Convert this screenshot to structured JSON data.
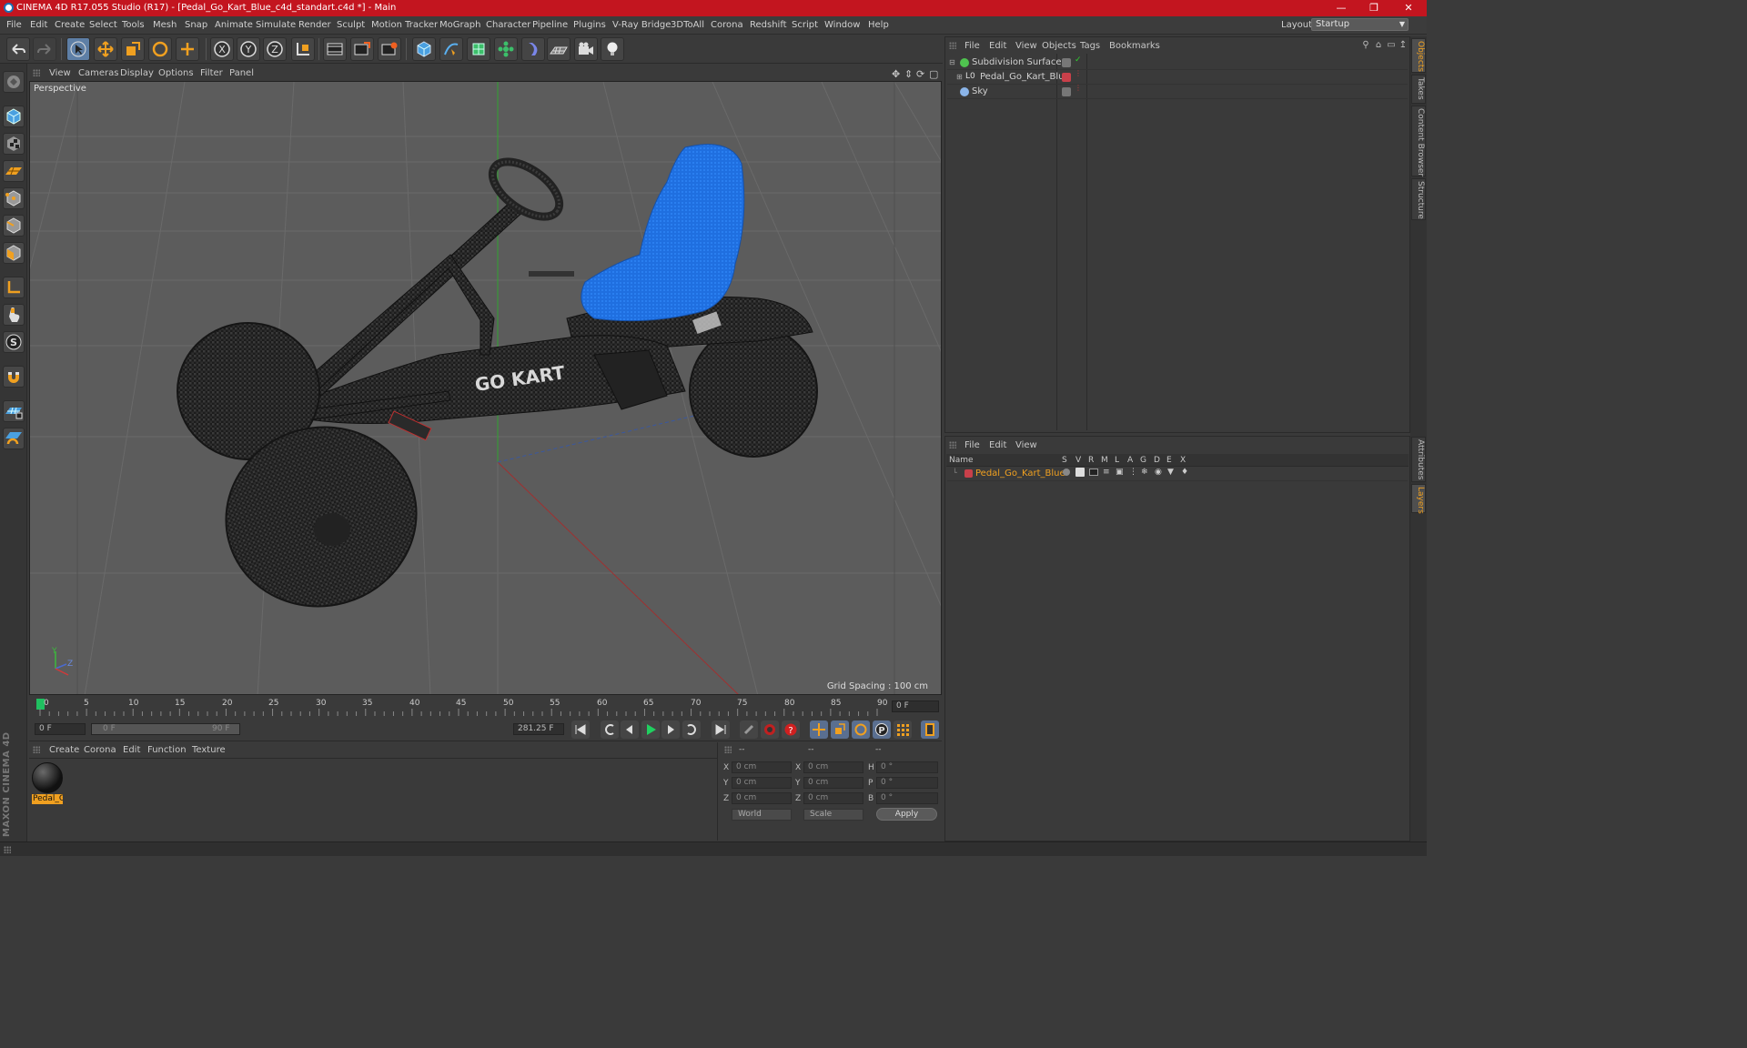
{
  "window": {
    "title": "CINEMA 4D R17.055 Studio (R17) - [Pedal_Go_Kart_Blue_c4d_standart.c4d *] - Main",
    "controls": [
      "minimize-icon",
      "restore-icon",
      "close-icon"
    ]
  },
  "menubar": {
    "items": [
      "File",
      "Edit",
      "Create",
      "Select",
      "Tools",
      "Mesh",
      "Snap",
      "Animate",
      "Simulate",
      "Render",
      "Sculpt",
      "Motion Tracker",
      "MoGraph",
      "Character",
      "Pipeline",
      "Plugins",
      "V-Ray Bridge",
      "3DToAll",
      "Corona",
      "Redshift",
      "Script",
      "Window",
      "Help"
    ],
    "layout_label": "Layout:",
    "layout_value": "Startup"
  },
  "toolbar": {
    "icons": [
      "undo-icon",
      "redo-icon",
      "live-select-icon",
      "move-icon",
      "scale-icon",
      "rotate-icon",
      "recent-tool-icon",
      "x-axis-icon",
      "y-axis-icon",
      "z-axis-icon",
      "coordinate-system-icon",
      "render-view-icon",
      "render-picture-viewer-icon",
      "edit-render-settings-icon",
      "cube-icon",
      "pen-spline-icon",
      "subdivision-icon",
      "array-icon",
      "deformer-icon",
      "floor-icon",
      "camera-icon",
      "light-icon"
    ],
    "axis_labels": [
      "X",
      "Y",
      "Z"
    ]
  },
  "left_tools": [
    "make-editable-icon",
    "model-mode-icon",
    "texture-mode-icon",
    "workplane-icon",
    "points-mode-icon",
    "edges-mode-icon",
    "polygons-mode-icon",
    "axis-mode-icon",
    "tweak-mode-icon",
    "solo-icon",
    "magnet-icon",
    "snap-grid-icon",
    "snap-settings-icon"
  ],
  "maxon_logo": "MAXON CINEMA 4D",
  "viewport": {
    "menu": [
      "View",
      "Cameras",
      "Display",
      "Options",
      "Filter",
      "Panel"
    ],
    "label": "Perspective",
    "grid_spacing": "Grid Spacing : 100 cm",
    "axis_labels": {
      "y": "Y",
      "z": "Z"
    },
    "kart_lettering": "GO KART"
  },
  "timeline": {
    "ticks": [
      "0",
      "5",
      "10",
      "15",
      "20",
      "25",
      "30",
      "35",
      "40",
      "45",
      "50",
      "55",
      "60",
      "65",
      "70",
      "75",
      "80",
      "85",
      "90"
    ],
    "current_frame": "0 F",
    "start_field": "0 F",
    "range_start": "0 F",
    "range_end": "90 F",
    "end_field": "281.25 F"
  },
  "material_manager": {
    "menu": [
      "Create",
      "Corona",
      "Edit",
      "Function",
      "Texture"
    ],
    "materials": [
      {
        "name": "Pedal_G"
      }
    ]
  },
  "coordinates": {
    "headers": [
      "--",
      "--",
      "--"
    ],
    "rows": [
      {
        "pos_label": "X",
        "pos": "0 cm",
        "size_label": "X",
        "size": "0 cm",
        "rot_label": "H",
        "rot": "0 °"
      },
      {
        "pos_label": "Y",
        "pos": "0 cm",
        "size_label": "Y",
        "size": "0 cm",
        "rot_label": "P",
        "rot": "0 °"
      },
      {
        "pos_label": "Z",
        "pos": "0 cm",
        "size_label": "Z",
        "size": "0 cm",
        "rot_label": "B",
        "rot": "0 °"
      }
    ],
    "mode_select": "World",
    "scale_select": "Scale",
    "apply_label": "Apply"
  },
  "object_manager": {
    "menu": [
      "File",
      "Edit",
      "View",
      "Objects",
      "Tags",
      "Bookmarks"
    ],
    "objects": [
      {
        "name": "Subdivision Surface",
        "icon_color": "#4fc34f"
      },
      {
        "name": "Pedal_Go_Kart_Blue",
        "icon_color": "#c7c7c7",
        "prefix": "L0"
      },
      {
        "name": "Sky",
        "icon_color": "#8ab4e8"
      }
    ]
  },
  "layer_manager": {
    "menu": [
      "File",
      "Edit",
      "View"
    ],
    "columns": [
      "Name",
      "S",
      "V",
      "R",
      "M",
      "L",
      "A",
      "G",
      "D",
      "E",
      "X"
    ],
    "layers": [
      {
        "name": "Pedal_Go_Kart_Blue",
        "color": "#c8404a"
      }
    ]
  },
  "side_tabs": [
    "Objects",
    "Takes",
    "Content Browser",
    "Structure",
    "Attributes",
    "Layers"
  ],
  "colors": {
    "titlebar": "#c3151f",
    "accent_orange": "#f0a020",
    "seat_blue": "#1f6fe0",
    "viewport_bg": "#5c5c5c"
  }
}
